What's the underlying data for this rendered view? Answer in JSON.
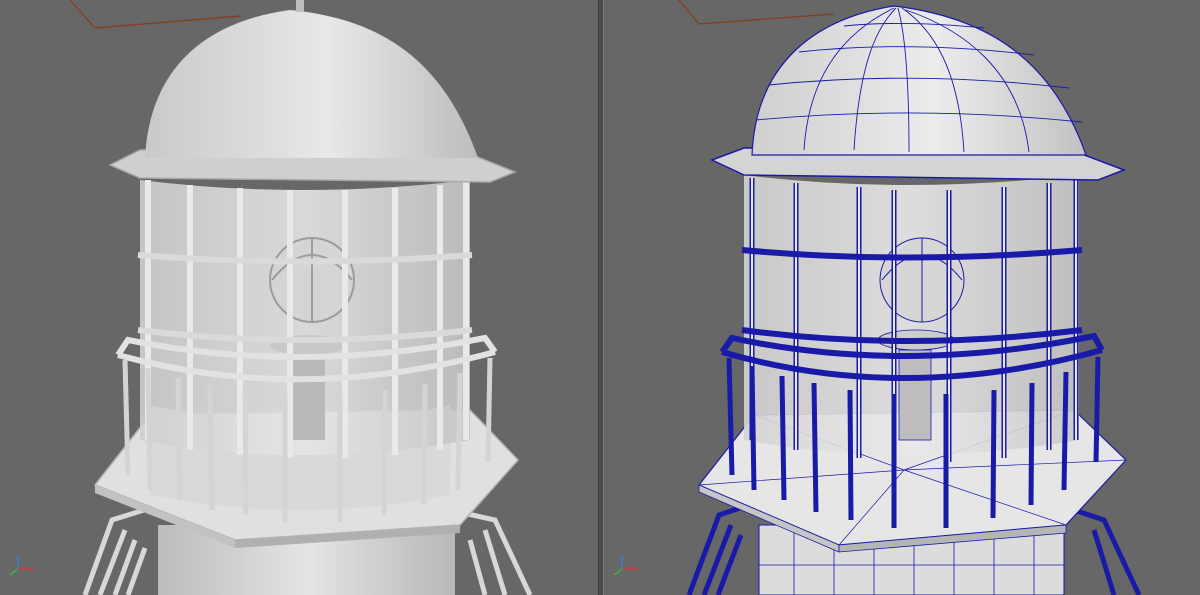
{
  "viewports": [
    {
      "id": "left",
      "mode": "shaded"
    },
    {
      "id": "right",
      "mode": "shaded-wireframe",
      "wire_color": "#1a1aa8"
    }
  ],
  "colors": {
    "background": "#676767",
    "splitter": "#4b4b4b",
    "shade_light": "#e2e2e2",
    "shade_mid": "#c6c6c6",
    "shade_dark": "#a9a9a9",
    "grid_line": "#8a3a1c"
  },
  "icons": {
    "axis_gizmo": "xyz-axis-icon"
  }
}
